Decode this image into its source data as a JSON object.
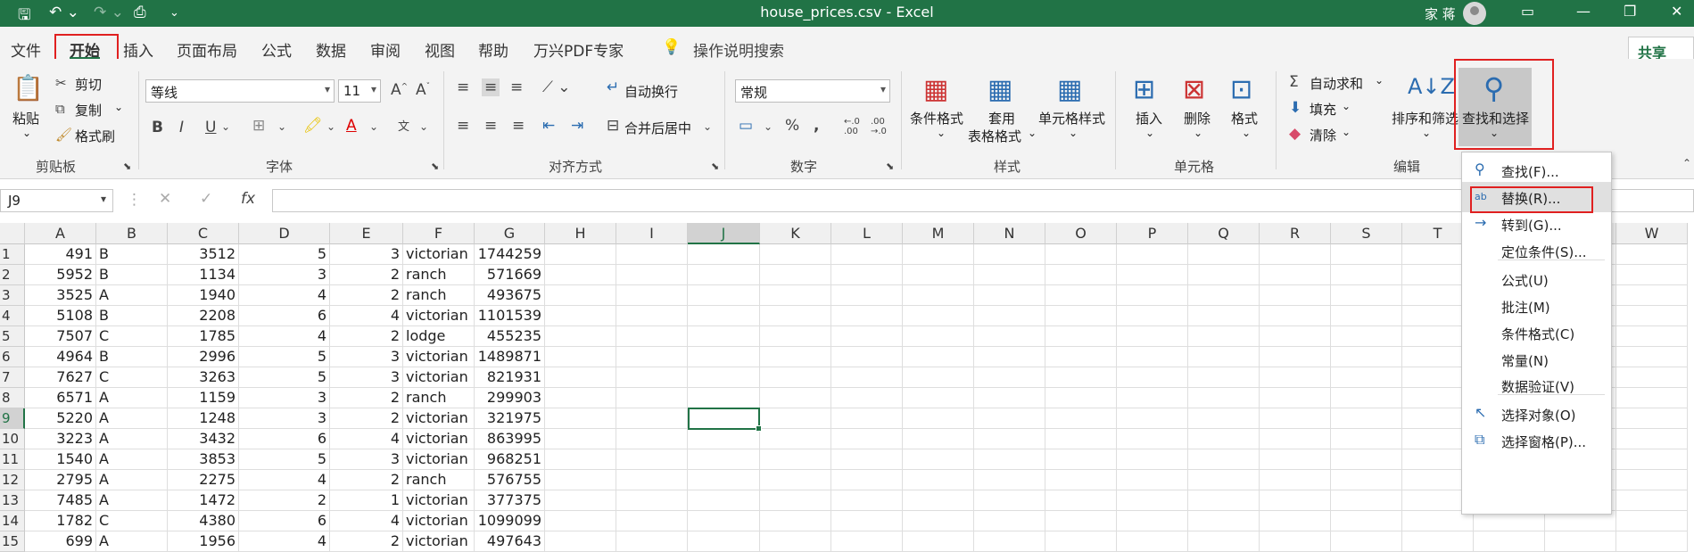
{
  "window": {
    "title": "house_prices.csv  -  Excel",
    "user": "家 蒋"
  },
  "menu": {
    "tabs": [
      "文件",
      "开始",
      "插入",
      "页面布局",
      "公式",
      "数据",
      "审阅",
      "视图",
      "帮助",
      "万兴PDF专家"
    ],
    "search": "操作说明搜索",
    "share": "共享"
  },
  "ribbon": {
    "clipboard": {
      "paste": "粘贴",
      "cut": "剪切",
      "copy": "复制",
      "painter": "格式刷",
      "group": "剪贴板"
    },
    "font": {
      "name": "等线",
      "size": "11",
      "group": "字体"
    },
    "align": {
      "wrap": "自动换行",
      "merge": "合并后居中",
      "group": "对齐方式"
    },
    "number": {
      "format": "常规",
      "group": "数字"
    },
    "styles": {
      "cond": "条件格式",
      "table1": "套用",
      "table2": "表格格式",
      "cell": "单元格样式",
      "group": "样式"
    },
    "cells": {
      "insert": "插入",
      "delete": "删除",
      "format": "格式",
      "group": "单元格"
    },
    "editing": {
      "autosum": "自动求和",
      "fill": "填充",
      "clear": "清除",
      "sort": "排序和筛选",
      "find": "查找和选择",
      "group": "编辑"
    }
  },
  "namebox": "J9",
  "columns": [
    "A",
    "B",
    "C",
    "D",
    "E",
    "F",
    "G",
    "H",
    "I",
    "J",
    "K",
    "L",
    "M",
    "N",
    "O",
    "P",
    "Q",
    "R",
    "S",
    "T",
    "U",
    "V",
    "W"
  ],
  "rows": [
    [
      "491",
      "B",
      "3512",
      "5",
      "3",
      "victorian",
      "1744259"
    ],
    [
      "5952",
      "B",
      "1134",
      "3",
      "2",
      "ranch",
      "571669"
    ],
    [
      "3525",
      "A",
      "1940",
      "4",
      "2",
      "ranch",
      "493675"
    ],
    [
      "5108",
      "B",
      "2208",
      "6",
      "4",
      "victorian",
      "1101539"
    ],
    [
      "7507",
      "C",
      "1785",
      "4",
      "2",
      "lodge",
      "455235"
    ],
    [
      "4964",
      "B",
      "2996",
      "5",
      "3",
      "victorian",
      "1489871"
    ],
    [
      "7627",
      "C",
      "3263",
      "5",
      "3",
      "victorian",
      "821931"
    ],
    [
      "6571",
      "A",
      "1159",
      "3",
      "2",
      "ranch",
      "299903"
    ],
    [
      "5220",
      "A",
      "1248",
      "3",
      "2",
      "victorian",
      "321975"
    ],
    [
      "3223",
      "A",
      "3432",
      "6",
      "4",
      "victorian",
      "863995"
    ],
    [
      "1540",
      "A",
      "3853",
      "5",
      "3",
      "victorian",
      "968251"
    ],
    [
      "2795",
      "A",
      "2275",
      "4",
      "2",
      "ranch",
      "576755"
    ],
    [
      "7485",
      "A",
      "1472",
      "2",
      "1",
      "victorian",
      "377375"
    ],
    [
      "1782",
      "C",
      "4380",
      "6",
      "4",
      "victorian",
      "1099099"
    ],
    [
      "699",
      "A",
      "1956",
      "4",
      "2",
      "victorian",
      "497643"
    ]
  ],
  "dropdown": [
    "查找(F)...",
    "替换(R)...",
    "转到(G)...",
    "定位条件(S)...",
    "公式(U)",
    "批注(M)",
    "条件格式(C)",
    "常量(N)",
    "数据验证(V)",
    "选择对象(O)",
    "选择窗格(P)..."
  ]
}
